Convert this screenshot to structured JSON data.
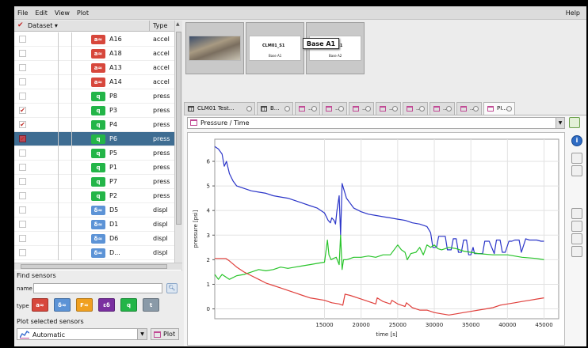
{
  "menu": {
    "items": [
      "File",
      "Edit",
      "View",
      "Plot"
    ],
    "help": "Help"
  },
  "dataset_table": {
    "headers": {
      "dataset": "Dataset ▾",
      "type": "Type"
    },
    "rows": [
      {
        "name": "A16",
        "badge": "a≈",
        "kind": "accel",
        "type": "accel",
        "checked": false,
        "selected": false
      },
      {
        "name": "A18",
        "badge": "a≈",
        "kind": "accel",
        "type": "accel",
        "checked": false,
        "selected": false
      },
      {
        "name": "A13",
        "badge": "a≈",
        "kind": "accel",
        "type": "accel",
        "checked": false,
        "selected": false
      },
      {
        "name": "A14",
        "badge": "a≈",
        "kind": "accel",
        "type": "accel",
        "checked": false,
        "selected": false
      },
      {
        "name": "P8",
        "badge": "q",
        "kind": "press",
        "type": "press",
        "checked": false,
        "selected": false
      },
      {
        "name": "P3",
        "badge": "q",
        "kind": "press",
        "type": "press",
        "checked": true,
        "selected": false
      },
      {
        "name": "P4",
        "badge": "q",
        "kind": "press",
        "type": "press",
        "checked": true,
        "selected": false
      },
      {
        "name": "P6",
        "badge": "q",
        "kind": "press",
        "type": "press",
        "checked": true,
        "selected": true
      },
      {
        "name": "P5",
        "badge": "q",
        "kind": "press",
        "type": "press",
        "checked": false,
        "selected": false
      },
      {
        "name": "P1",
        "badge": "q",
        "kind": "press",
        "type": "press",
        "checked": false,
        "selected": false
      },
      {
        "name": "P7",
        "badge": "q",
        "kind": "press",
        "type": "press",
        "checked": false,
        "selected": false
      },
      {
        "name": "P2",
        "badge": "q",
        "kind": "press",
        "type": "press",
        "checked": false,
        "selected": false
      },
      {
        "name": "D5",
        "badge": "δ≈",
        "kind": "displ",
        "type": "displ",
        "checked": false,
        "selected": false
      },
      {
        "name": "D1",
        "badge": "δ≈",
        "kind": "displ",
        "type": "displ",
        "checked": false,
        "selected": false
      },
      {
        "name": "D6",
        "badge": "δ≈",
        "kind": "displ",
        "type": "displ",
        "checked": false,
        "selected": false
      },
      {
        "name": "D...",
        "badge": "δ≈",
        "kind": "displ",
        "type": "displ",
        "checked": false,
        "selected": false
      }
    ]
  },
  "find_sensors": {
    "title": "Find sensors",
    "name_label": "name",
    "name_value": "",
    "type_label": "type",
    "type_buttons": [
      {
        "id": "accel",
        "label": "a≈",
        "color": "#d7473c"
      },
      {
        "id": "displ",
        "label": "δ≈",
        "color": "#5c93d6"
      },
      {
        "id": "force",
        "label": "F≈",
        "color": "#f0a020"
      },
      {
        "id": "strain",
        "label": "εδ",
        "color": "#7a2fa0"
      },
      {
        "id": "press",
        "label": "q",
        "color": "#23b548"
      },
      {
        "id": "temp",
        "label": "t",
        "color": "#8a9aa8"
      }
    ]
  },
  "plot_selected": {
    "title": "Plot selected sensors",
    "mode": "Automatic",
    "plot_button": "Plot"
  },
  "thumbnails": [
    {
      "caption": "",
      "sub": ""
    },
    {
      "caption": "CLM01_S1",
      "sub": "Base A1"
    },
    {
      "caption": "AM01_S1",
      "sub": "Base A2"
    }
  ],
  "tooltip": "Base A1",
  "tabs": [
    "CLM01 Test...",
    "B...",
    "...",
    "...",
    "...",
    "...",
    "...",
    "...",
    "...",
    "PI..."
  ],
  "plot_title": "Pressure / Time",
  "chart_data": {
    "type": "line",
    "title": "",
    "xlabel": "time [s]",
    "ylabel": "pressure [psi]",
    "xlim": [
      0,
      47000
    ],
    "ylim": [
      -0.4,
      6.9
    ],
    "xticks": [
      15000,
      20000,
      25000,
      30000,
      35000,
      40000,
      45000
    ],
    "yticks": [
      0,
      1,
      2,
      3,
      4,
      5,
      6
    ],
    "grid": true,
    "series": [
      {
        "color": "#2b35c8",
        "x": [
          0,
          500,
          1000,
          1300,
          1600,
          2000,
          2500,
          3000,
          4000,
          5000,
          6000,
          7000,
          8000,
          9000,
          10000,
          11000,
          12000,
          13000,
          14000,
          15000,
          15500,
          15800,
          16000,
          16300,
          16500,
          16700,
          17000,
          17200,
          17400,
          17600,
          17800,
          18000,
          18500,
          19000,
          20000,
          21000,
          22000,
          23000,
          24000,
          25000,
          26000,
          27000,
          28000,
          29000,
          29500,
          29800,
          30300,
          30600,
          31500,
          31800,
          32300,
          32600,
          33000,
          33300,
          33700,
          34000,
          34400,
          34700,
          35000,
          35300,
          35500,
          36000,
          36600,
          36900,
          37500,
          38200,
          38500,
          39000,
          39300,
          39700,
          40200,
          40600,
          41000,
          41600,
          41900,
          42500,
          43000,
          43600,
          44000,
          44600,
          45000
        ],
        "y": [
          6.6,
          6.5,
          6.3,
          5.8,
          6.0,
          5.5,
          5.2,
          5.0,
          4.9,
          4.8,
          4.75,
          4.7,
          4.6,
          4.55,
          4.5,
          4.4,
          4.3,
          4.2,
          4.1,
          3.9,
          3.6,
          3.5,
          3.7,
          3.6,
          3.45,
          4.0,
          4.6,
          3.0,
          5.1,
          4.9,
          4.7,
          4.5,
          4.3,
          4.1,
          3.95,
          3.85,
          3.8,
          3.75,
          3.7,
          3.65,
          3.6,
          3.5,
          3.45,
          3.35,
          3.1,
          2.5,
          2.5,
          2.95,
          2.95,
          2.4,
          2.4,
          2.85,
          2.85,
          2.3,
          2.3,
          2.8,
          2.8,
          2.2,
          2.2,
          2.5,
          2.25,
          2.25,
          2.25,
          2.75,
          2.75,
          2.25,
          2.8,
          2.8,
          2.3,
          2.3,
          2.75,
          2.75,
          2.8,
          2.8,
          2.3,
          2.85,
          2.8,
          2.8,
          2.8,
          2.75,
          2.75
        ]
      },
      {
        "color": "#28c42a",
        "x": [
          0,
          500,
          1000,
          2000,
          3000,
          4000,
          5000,
          6000,
          7000,
          8000,
          9000,
          10000,
          11000,
          12000,
          13000,
          14000,
          15000,
          15400,
          15600,
          15900,
          16200,
          16600,
          17000,
          17200,
          17400,
          17600,
          18000,
          19000,
          20000,
          21000,
          22000,
          23000,
          24000,
          25000,
          25500,
          26000,
          26300,
          26800,
          27500,
          28000,
          28500,
          29000,
          29500,
          30000,
          30500,
          31000,
          32000,
          33000,
          34000,
          35000,
          36000,
          38000,
          40000,
          42000,
          44000,
          45000
        ],
        "y": [
          1.4,
          1.2,
          1.4,
          1.2,
          1.35,
          1.4,
          1.5,
          1.6,
          1.55,
          1.6,
          1.7,
          1.65,
          1.7,
          1.75,
          1.8,
          1.85,
          1.9,
          2.8,
          2.2,
          2.0,
          2.05,
          2.1,
          1.8,
          3.0,
          1.6,
          2.0,
          2.0,
          2.1,
          2.1,
          2.15,
          2.1,
          2.2,
          2.2,
          2.6,
          2.4,
          2.3,
          2.0,
          2.25,
          2.3,
          2.5,
          2.2,
          2.6,
          2.5,
          2.6,
          2.45,
          2.4,
          2.5,
          2.45,
          2.35,
          2.3,
          2.25,
          2.2,
          2.2,
          2.1,
          2.05,
          2.0
        ]
      },
      {
        "color": "#e0403c",
        "x": [
          0,
          1500,
          2000,
          3000,
          4000,
          5000,
          6000,
          7000,
          8000,
          9000,
          10000,
          11000,
          12000,
          13000,
          14000,
          15000,
          16000,
          17000,
          17500,
          17800,
          18500,
          19000,
          19500,
          20000,
          21000,
          22000,
          22200,
          23000,
          24000,
          24200,
          25000,
          26000,
          26200,
          27000,
          28000,
          29000,
          30000,
          31000,
          32000,
          33000,
          34000,
          35000,
          36000,
          37000,
          38000,
          39000,
          40000,
          41000,
          42000,
          43000,
          44000,
          45000
        ],
        "y": [
          2.05,
          2.05,
          1.95,
          1.7,
          1.5,
          1.35,
          1.2,
          1.05,
          0.95,
          0.85,
          0.75,
          0.65,
          0.55,
          0.45,
          0.4,
          0.35,
          0.25,
          0.2,
          0.15,
          0.6,
          0.55,
          0.5,
          0.45,
          0.4,
          0.3,
          0.2,
          0.45,
          0.3,
          0.2,
          0.35,
          0.2,
          0.1,
          0.25,
          0.05,
          -0.05,
          -0.05,
          -0.15,
          -0.2,
          -0.25,
          -0.2,
          -0.15,
          -0.1,
          -0.05,
          0.0,
          0.05,
          0.15,
          0.2,
          0.25,
          0.3,
          0.35,
          0.4,
          0.45
        ]
      }
    ]
  }
}
